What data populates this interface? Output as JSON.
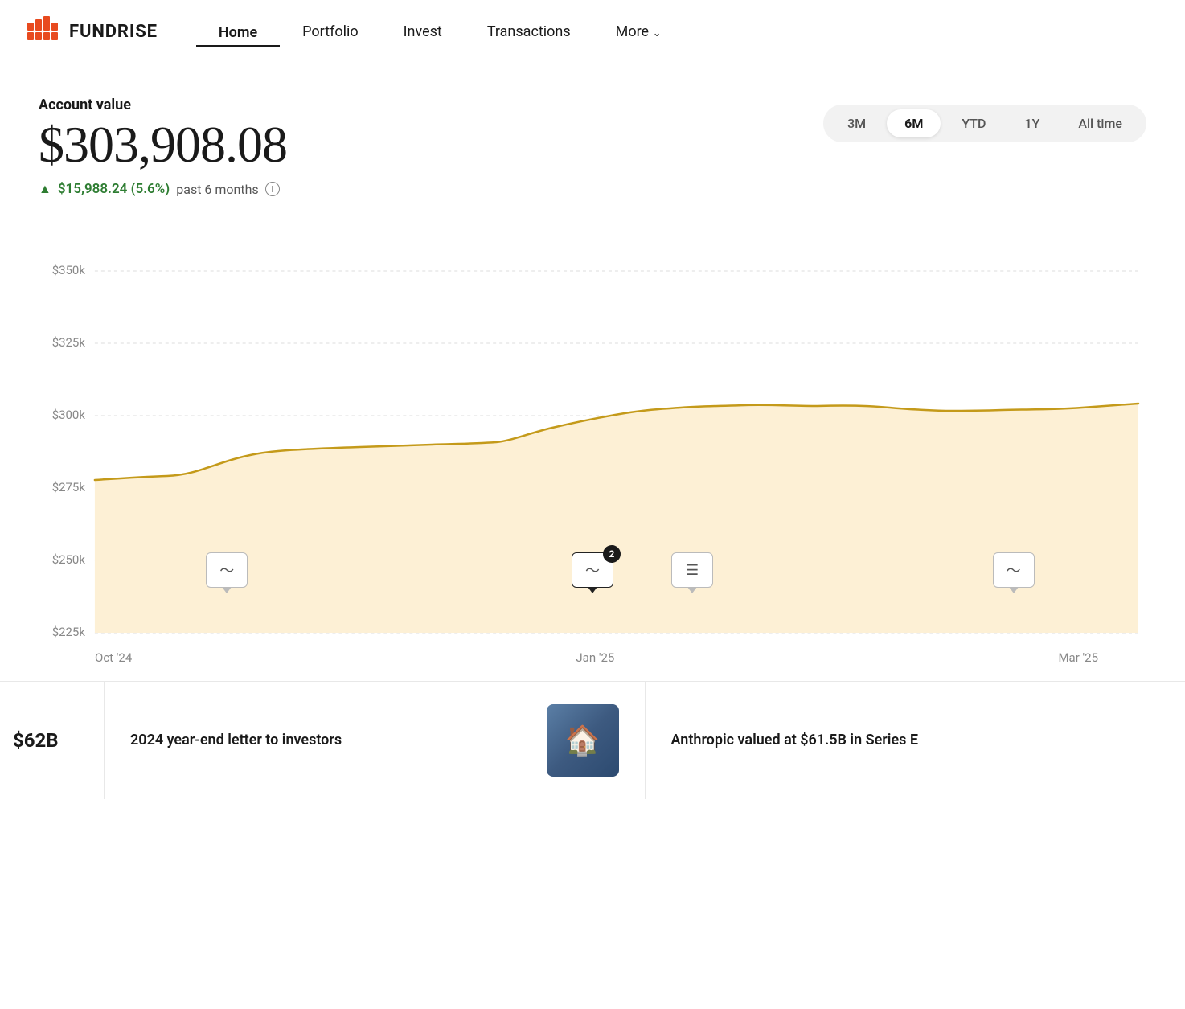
{
  "nav": {
    "logo_text": "FUNDRISE",
    "links": [
      {
        "label": "Home",
        "active": true
      },
      {
        "label": "Portfolio",
        "active": false
      },
      {
        "label": "Invest",
        "active": false
      },
      {
        "label": "Transactions",
        "active": false
      },
      {
        "label": "More",
        "active": false,
        "hasChevron": true
      }
    ]
  },
  "account": {
    "label": "Account value",
    "value": "$303,908.08",
    "change_amount": "$15,988.24 (5.6%)",
    "change_period": "past 6 months",
    "info_label": "i"
  },
  "time_filter": {
    "options": [
      "3M",
      "6M",
      "YTD",
      "1Y",
      "All time"
    ],
    "active": "6M"
  },
  "chart": {
    "y_labels": [
      "$350k",
      "$325k",
      "$300k",
      "$275k",
      "$250k",
      "$225k"
    ],
    "x_labels": [
      "Oct '24",
      "Jan '25",
      "Mar '25"
    ],
    "accent_color": "#c49a1a",
    "fill_color": "#fdf3e0"
  },
  "markers": [
    {
      "id": "m1",
      "left_pct": 17,
      "icon": "trend",
      "badge": null
    },
    {
      "id": "m2",
      "left_pct": 50,
      "icon": "trend",
      "badge": 2
    },
    {
      "id": "m3",
      "left_pct": 59,
      "icon": "lines",
      "badge": null
    },
    {
      "id": "m4",
      "left_pct": 88,
      "icon": "trend",
      "badge": null
    }
  ],
  "news": [
    {
      "tag": "$62B",
      "title": "",
      "partial": true
    },
    {
      "tag": "",
      "title": "2024 year-end letter to investors",
      "has_thumb": true
    },
    {
      "tag": "",
      "title": "Anthropic valued at $61.5B in Series E",
      "has_thumb": false
    }
  ]
}
